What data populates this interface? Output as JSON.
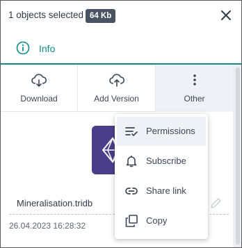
{
  "header": {
    "selection_text": "1 objects selected",
    "size_badge": "64 Kb"
  },
  "tabs": {
    "info_label": "Info"
  },
  "actions": [
    {
      "label": "Download",
      "icon": "cloud-download-icon"
    },
    {
      "label": "Add Version",
      "icon": "cloud-upload-icon"
    },
    {
      "label": "Other",
      "icon": "vertical-dots-icon"
    }
  ],
  "file": {
    "name": "Mineralisation.tridb",
    "modified": "26.04.2023 16:28:32"
  },
  "menu": {
    "items": [
      {
        "label": "Permissions",
        "icon": "permissions-icon"
      },
      {
        "label": "Subscribe",
        "icon": "bell-icon"
      },
      {
        "label": "Share link",
        "icon": "link-icon"
      },
      {
        "label": "Copy",
        "icon": "copy-icon"
      }
    ]
  },
  "colors": {
    "accent": "#0f8b8d",
    "badge_bg": "#4a5361",
    "thumb_bg": "#4a3d8a"
  }
}
